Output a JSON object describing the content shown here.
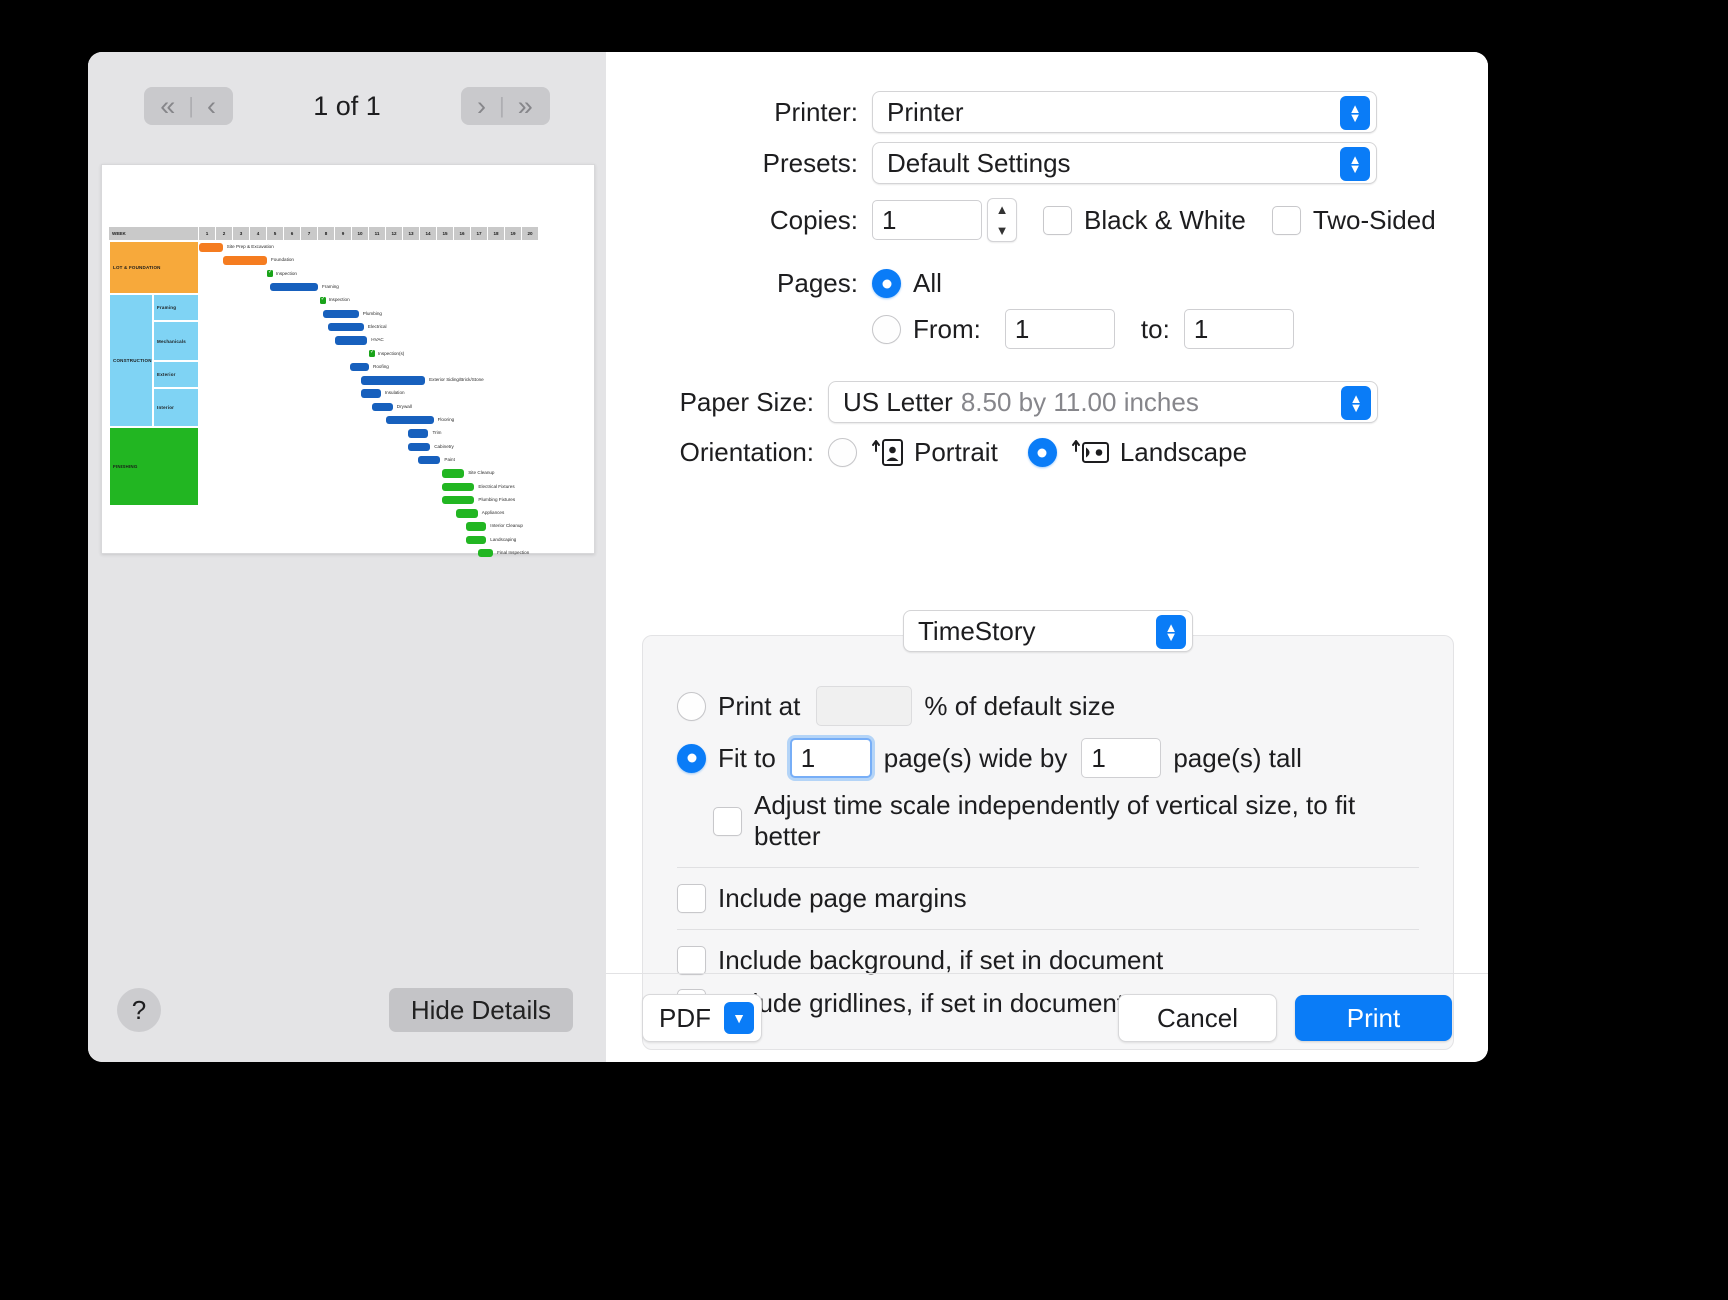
{
  "preview": {
    "pager": {
      "first_label": "«",
      "prev_label": "‹",
      "sep": "|",
      "next_label": "›",
      "last_label": "»",
      "page_indicator": "1 of 1"
    },
    "help_label": "?",
    "hide_details_label": "Hide Details"
  },
  "chart_data": {
    "type": "bar",
    "title": "",
    "xlabel": "WEEK",
    "ylabel": "",
    "week_header_label": "WEEK",
    "weeks": [
      "1",
      "2",
      "3",
      "4",
      "5",
      "6",
      "7",
      "8",
      "9",
      "10",
      "11",
      "12",
      "13",
      "14",
      "15",
      "16",
      "17",
      "18",
      "19",
      "20"
    ],
    "phases": [
      {
        "label": "LOT & FOUNDATION",
        "color": "#f7a93b"
      },
      {
        "label": "CONSTRUCTION",
        "color": "#7fd3f4"
      },
      {
        "label": "FINISHING",
        "color": "#22b622"
      }
    ],
    "subphases": [
      {
        "label": "Framing",
        "color": "#7fd3f4"
      },
      {
        "label": "Mechanicals",
        "color": "#7fd3f4"
      },
      {
        "label": "Exterior",
        "color": "#7fd3f4"
      },
      {
        "label": "Interior",
        "color": "#7fd3f4"
      }
    ],
    "tasks": [
      {
        "name": "Site Prep & Excavation",
        "start": 1.0,
        "end": 2.4,
        "color": "#f57c20",
        "kind": "bar"
      },
      {
        "name": "Foundation",
        "start": 2.4,
        "end": 5.0,
        "color": "#f57c20",
        "kind": "bar"
      },
      {
        "name": "Inspection",
        "start": 5.0,
        "end": 5.0,
        "color": "#19a319",
        "kind": "milestone"
      },
      {
        "name": "Framing",
        "start": 5.2,
        "end": 8.0,
        "color": "#1760bd",
        "kind": "bar"
      },
      {
        "name": "Inspection",
        "start": 8.1,
        "end": 8.1,
        "color": "#19a319",
        "kind": "milestone"
      },
      {
        "name": "Plumbing",
        "start": 8.3,
        "end": 10.4,
        "color": "#1760bd",
        "kind": "bar"
      },
      {
        "name": "Electrical",
        "start": 8.6,
        "end": 10.7,
        "color": "#1760bd",
        "kind": "bar"
      },
      {
        "name": "HVAC",
        "start": 9.0,
        "end": 10.9,
        "color": "#1760bd",
        "kind": "bar"
      },
      {
        "name": "Inspection(s)",
        "start": 11.0,
        "end": 11.0,
        "color": "#19a319",
        "kind": "milestone"
      },
      {
        "name": "Roofing",
        "start": 9.9,
        "end": 11.0,
        "color": "#1760bd",
        "kind": "bar"
      },
      {
        "name": "Exterior Siding/Brick/Stone",
        "start": 10.5,
        "end": 14.3,
        "color": "#1760bd",
        "kind": "bar"
      },
      {
        "name": "Insulation",
        "start": 10.5,
        "end": 11.7,
        "color": "#1760bd",
        "kind": "bar"
      },
      {
        "name": "Drywall",
        "start": 11.2,
        "end": 12.4,
        "color": "#1760bd",
        "kind": "bar"
      },
      {
        "name": "Flooring",
        "start": 12.0,
        "end": 14.8,
        "color": "#1760bd",
        "kind": "bar"
      },
      {
        "name": "Trim",
        "start": 13.3,
        "end": 14.5,
        "color": "#1760bd",
        "kind": "bar"
      },
      {
        "name": "Cabinetry",
        "start": 13.3,
        "end": 14.6,
        "color": "#1760bd",
        "kind": "bar"
      },
      {
        "name": "Paint",
        "start": 13.9,
        "end": 15.2,
        "color": "#1760bd",
        "kind": "bar"
      },
      {
        "name": "Site Cleanup",
        "start": 15.3,
        "end": 16.6,
        "color": "#22b622",
        "kind": "bar"
      },
      {
        "name": "Electrical Fixtures",
        "start": 15.3,
        "end": 17.2,
        "color": "#22b622",
        "kind": "bar"
      },
      {
        "name": "Plumbing Fixtures",
        "start": 15.3,
        "end": 17.2,
        "color": "#22b622",
        "kind": "bar"
      },
      {
        "name": "Appliances",
        "start": 16.1,
        "end": 17.4,
        "color": "#22b622",
        "kind": "bar"
      },
      {
        "name": "Interior Cleanup",
        "start": 16.7,
        "end": 17.9,
        "color": "#22b622",
        "kind": "bar"
      },
      {
        "name": "Landscaping",
        "start": 16.7,
        "end": 17.9,
        "color": "#22b622",
        "kind": "bar"
      },
      {
        "name": "Final Inspection",
        "start": 17.4,
        "end": 18.3,
        "color": "#22b622",
        "kind": "bar"
      }
    ]
  },
  "settings": {
    "printer": {
      "label": "Printer:",
      "value": "Printer"
    },
    "presets": {
      "label": "Presets:",
      "value": "Default Settings"
    },
    "copies": {
      "label": "Copies:",
      "value": "1"
    },
    "black_white": {
      "label": "Black & White",
      "checked": false
    },
    "two_sided": {
      "label": "Two-Sided",
      "checked": false
    },
    "pages": {
      "label": "Pages:",
      "all_label": "All",
      "from_label": "From:",
      "from_value": "1",
      "to_label": "to:",
      "to_value": "1",
      "selected": "all"
    },
    "paper_size": {
      "label": "Paper Size:",
      "value": "US Letter",
      "dimensions": "8.50 by 11.00 inches"
    },
    "orientation": {
      "label": "Orientation:",
      "portrait_label": "Portrait",
      "landscape_label": "Landscape",
      "selected": "landscape"
    }
  },
  "options": {
    "module_name": "TimeStory",
    "print_at": {
      "label": "Print at",
      "value": "",
      "suffix": "% of default size",
      "selected": false
    },
    "fit_to": {
      "label": "Fit to",
      "wide_value": "1",
      "mid_label": "page(s) wide by",
      "tall_value": "1",
      "suffix": "page(s) tall",
      "selected": true
    },
    "adjust_time_scale": {
      "label": "Adjust time scale independently of vertical size, to fit better",
      "checked": false
    },
    "include_page_margins": {
      "label": "Include page margins",
      "checked": false
    },
    "include_background": {
      "label": "Include background, if set in document",
      "checked": false
    },
    "include_gridlines": {
      "label": "Include gridlines, if set in document",
      "checked": false
    }
  },
  "actions": {
    "pdf_label": "PDF",
    "cancel_label": "Cancel",
    "print_label": "Print"
  },
  "colors": {
    "accent": "#0a7cf7",
    "window_bg": "#ffffff",
    "sidebar_bg": "#e4e4e6",
    "options_bg": "#f6f6f7"
  }
}
